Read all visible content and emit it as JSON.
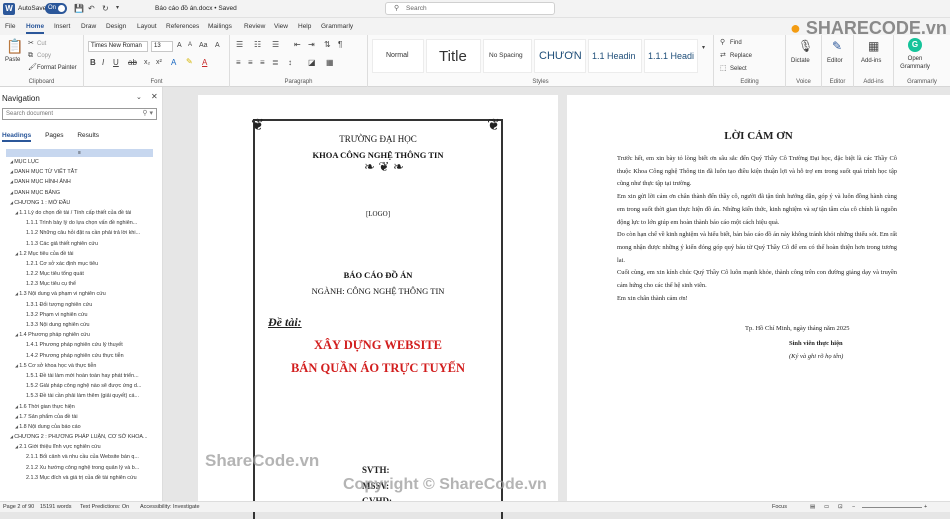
{
  "titlebar": {
    "autosave": "AutoSave",
    "toggle": "On",
    "doc_title": "Báo cáo đồ án.docx • Saved",
    "search_placeholder": "Search"
  },
  "menu": [
    "File",
    "Home",
    "Insert",
    "Draw",
    "Design",
    "Layout",
    "References",
    "Mailings",
    "Review",
    "View",
    "Help",
    "Grammarly"
  ],
  "ribbon": {
    "clipboard": {
      "paste": "Paste",
      "cut": "Cut",
      "copy": "Copy",
      "format_painter": "Format Painter",
      "label": "Clipboard"
    },
    "font": {
      "name": "Times New Roman",
      "size": "13",
      "label": "Font"
    },
    "paragraph": {
      "label": "Paragraph"
    },
    "styles": {
      "items": [
        "Normal",
        "Title",
        "No Spacing",
        "CHƯƠN",
        "1.1 Headin",
        "1.1.1 Headi"
      ],
      "label": "Styles"
    },
    "editing": {
      "find": "Find",
      "replace": "Replace",
      "select": "Select",
      "label": "Editing"
    },
    "voice": {
      "dictate": "Dictate",
      "label": "Voice"
    },
    "editor": {
      "editor": "Editor",
      "label": "Editor"
    },
    "addins": {
      "addins": "Add-ins",
      "label": "Add-ins"
    },
    "grammarly": {
      "open": "Open Grammarly",
      "label": "Grammarly"
    }
  },
  "nav": {
    "title": "Navigation",
    "search_placeholder": "Search document",
    "tabs": [
      "Headings",
      "Pages",
      "Results"
    ],
    "items": [
      {
        "t": "MỤC LỤC",
        "l": "l0"
      },
      {
        "t": "DANH MỤC TỪ VIẾT TẮT",
        "l": "l0"
      },
      {
        "t": "DANH MỤC HÌNH ẢNH",
        "l": "l0"
      },
      {
        "t": "DANH MỤC BẢNG",
        "l": "l0"
      },
      {
        "t": "CHƯƠNG 1 : MỞ ĐẦU",
        "l": "l0"
      },
      {
        "t": "1.1 Lý do chọn đề tài / Tính cấp thiết của đề tài",
        "l": "l1"
      },
      {
        "t": "1.1.1 Trình bày lý do lựa chọn vấn đề nghiên...",
        "l": "l2"
      },
      {
        "t": "1.1.2 Những câu hỏi đặt ra cần phải trả lời khi...",
        "l": "l2"
      },
      {
        "t": "1.1.3 Các giả thiết nghiên cứu",
        "l": "l2"
      },
      {
        "t": "1.2 Mục tiêu của đề tài",
        "l": "l1"
      },
      {
        "t": "1.2.1 Cơ sở xác định mục tiêu",
        "l": "l2"
      },
      {
        "t": "1.2.2 Mục tiêu tổng quát",
        "l": "l2"
      },
      {
        "t": "1.2.3 Mục tiêu cụ thể",
        "l": "l2"
      },
      {
        "t": "1.3 Nội dung và phạm vi nghiên cứu",
        "l": "l1"
      },
      {
        "t": "1.3.1 Đối tượng nghiên cứu",
        "l": "l2"
      },
      {
        "t": "1.3.2 Phạm vi nghiên cứu",
        "l": "l2"
      },
      {
        "t": "1.3.3 Nội dung nghiên cứu",
        "l": "l2"
      },
      {
        "t": "1.4 Phương pháp nghiên cứu",
        "l": "l1"
      },
      {
        "t": "1.4.1 Phương pháp nghiên cứu lý thuyết",
        "l": "l2"
      },
      {
        "t": "1.4.2 Phương pháp nghiên cứu thực tiễn",
        "l": "l2"
      },
      {
        "t": "1.5 Cơ sở khoa học và thực tiễn",
        "l": "l1"
      },
      {
        "t": "1.5.1 Đề tài làm mới hoàn toàn hay phát triển...",
        "l": "l2"
      },
      {
        "t": "1.5.2 Giải pháp công nghệ nào sẽ được ứng d...",
        "l": "l2"
      },
      {
        "t": "1.5.3 Đề tài cần phải làm thêm (giải quyết) cá...",
        "l": "l2"
      },
      {
        "t": "1.6 Thời gian thực hiện",
        "l": "l1"
      },
      {
        "t": "1.7 Sản phẩm của đề tài",
        "l": "l1"
      },
      {
        "t": "1.8 Nội dung của báo cáo",
        "l": "l1"
      },
      {
        "t": "CHƯƠNG 2 : PHƯƠNG PHÁP LUẬN, CƠ SỞ KHOA...",
        "l": "l0"
      },
      {
        "t": "2.1 Giới thiệu lĩnh vực nghiên cứu",
        "l": "l1"
      },
      {
        "t": "2.1.1 Bối cảnh và nhu cầu của Website bán q...",
        "l": "l2"
      },
      {
        "t": "2.1.2 Xu hướng công nghệ trong quản lý và b...",
        "l": "l2"
      },
      {
        "t": "2.1.3 Mục đích và giá trị của đề tài nghiên cứu",
        "l": "l2"
      }
    ]
  },
  "page1": {
    "school": "TRƯỜNG ĐẠI HỌC",
    "faculty": "KHOA CÔNG NGHỆ THÔNG TIN",
    "logo": "[LOGO]",
    "report": "BÁO CÁO ĐỒ ÁN",
    "major": "NGÀNH: CÔNG NGHỆ THÔNG TIN",
    "topic_label": "Đề tài:",
    "topic_1": "XÂY DỰNG WEBSITE",
    "topic_2": "BÁN QUẦN ÁO TRỰC TUYẾN",
    "svth": "SVTH:",
    "mssv": "MSSV:",
    "gvhd": "GVHD:"
  },
  "page2": {
    "heading": "LỜI CẢM ƠN",
    "paragraphs": [
      "Trước hết, em xin bày tỏ lòng biết ơn sâu sắc đến Quý Thầy Cô Trường Đại học, đặc biệt là các Thầy Cô thuộc Khoa Công nghệ Thông tin đã luôn tạo điều kiện thuận lợi và hỗ trợ em trong suốt quá trình học tập cũng như thực tập tại trường.",
      "Em xin gửi lời cảm ơn chân thành đến thầy cô, người đã tận tình hướng dẫn, góp ý và luôn đồng hành cùng em trong suốt thời gian thực hiện đồ án. Những kiến thức, kinh nghiệm và sự tận tâm của cô chính là nguồn động lực to lớn giúp em hoàn thành báo cáo một cách hiệu quả.",
      "Do còn hạn chế về kinh nghiệm và hiểu biết, bản báo cáo đồ án này không tránh khỏi những thiếu sót. Em rất mong nhận được những ý kiến đóng góp quý báu từ Quý Thầy Cô để em có thể hoàn thiện hơn trong tương lai.",
      "Cuối cùng, em xin kính chúc Quý Thầy Cô luôn mạnh khỏe, thành công trên con đường giảng dạy và truyền cảm hứng cho các thế hệ sinh viên.",
      "Em xin chân thành cảm ơn!"
    ],
    "place_date": "Tp. Hồ Chí Minh, ngày      tháng      năm 2025",
    "signer": "Sinh viên thực hiện",
    "sign_note": "(Ký và ghi rõ họ tên)"
  },
  "status": {
    "page": "Page 2 of 90",
    "words": "15191 words",
    "predictions": "Text Predictions: On",
    "accessibility": "Accessibility: Investigate",
    "focus": "Focus"
  },
  "watermark": {
    "logo": "SHARECODE.vn",
    "mid": "ShareCode.vn",
    "copyright": "Copyright © ShareCode.vn"
  }
}
